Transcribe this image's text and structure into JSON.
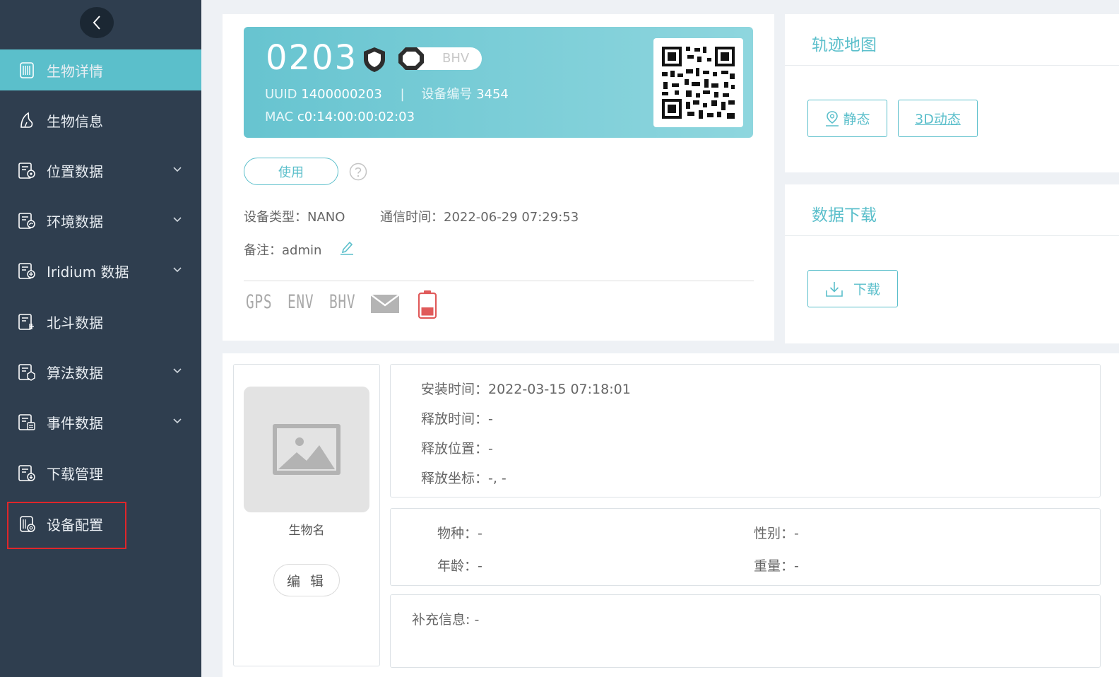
{
  "sidebar": {
    "items": [
      {
        "label": "生物详情",
        "icon": "book-icon",
        "active": true
      },
      {
        "label": "生物信息",
        "icon": "animal-icon"
      },
      {
        "label": "位置数据",
        "icon": "location-doc-icon",
        "expandable": true
      },
      {
        "label": "环境数据",
        "icon": "env-doc-icon",
        "expandable": true
      },
      {
        "label": "Iridium 数据",
        "icon": "iridium-doc-icon",
        "expandable": true
      },
      {
        "label": "北斗数据",
        "icon": "beidou-doc-icon"
      },
      {
        "label": "算法数据",
        "icon": "algo-doc-icon",
        "expandable": true
      },
      {
        "label": "事件数据",
        "icon": "event-doc-icon",
        "expandable": true
      },
      {
        "label": "下载管理",
        "icon": "download-doc-icon"
      },
      {
        "label": "设备配置",
        "icon": "device-config-icon",
        "highlighted": true
      }
    ],
    "colors": {
      "background": "#2f3e4f",
      "active": "#5bbfcb",
      "highlight_border": "#e0262a"
    }
  },
  "device": {
    "id": "0203",
    "bhv_label": "BHV",
    "uuid_label": "UUID",
    "uuid": "1400000203",
    "separator": "|",
    "serial_label": "设备编号",
    "serial": "3454",
    "mac_label": "MAC",
    "mac": "c0:14:00:00:02:03",
    "use_button": "使用",
    "type_text": "设备类型：NANO",
    "comm_text": "通信时间：2022-06-29 07:29:53",
    "note_text": "备注：admin",
    "status": {
      "gps": "GPS",
      "env": "ENV",
      "bhv": "BHV"
    }
  },
  "track": {
    "title": "轨迹地图",
    "static_label": "静态",
    "dynamic_label": "3D动态"
  },
  "download": {
    "title": "数据下载",
    "button_label": "下载"
  },
  "animal": {
    "name_caption": "生物名",
    "edit_label": "编 辑",
    "install_time": "安装时间：2022-03-15 07:18:01",
    "release_time": "释放时间：-",
    "release_location": "释放位置：-",
    "release_coords": "释放坐标：-, -",
    "species": "物种：-",
    "gender": "性别：-",
    "age": "年龄：-",
    "weight": "重量：-",
    "extra": "补充信息: -"
  },
  "theme": {
    "accent": "#5bbfcb",
    "battery_low": "#e05a5a"
  }
}
